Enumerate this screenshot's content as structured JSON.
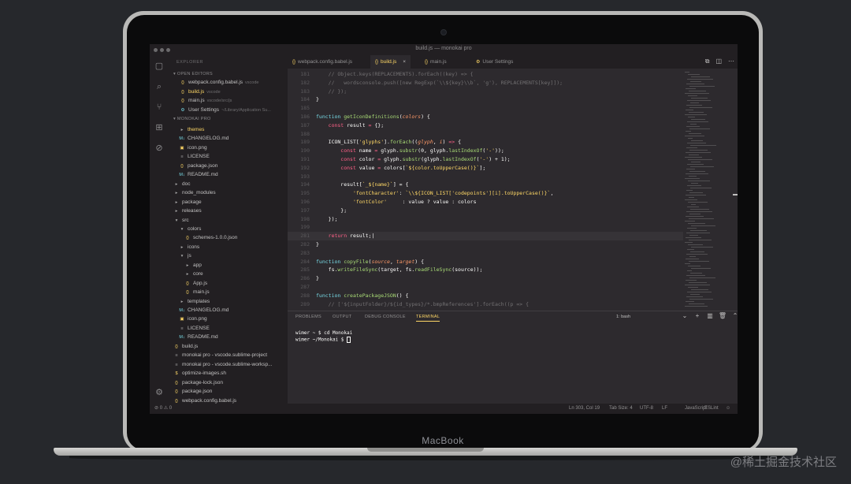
{
  "device": {
    "brand": "MacBook"
  },
  "window": {
    "title": "build.js — monokai pro"
  },
  "activity_bar": {
    "icons": [
      "files-icon",
      "search-icon",
      "source-control-icon",
      "extensions-icon",
      "debug-icon",
      "settings-icon"
    ]
  },
  "sidebar": {
    "header": "EXPLORER",
    "open_editors_label": "OPEN EDITORS",
    "open_editors": [
      {
        "name": "webpack.config.babel.js",
        "sub": "vscode",
        "kind": "js"
      },
      {
        "name": "build.js",
        "sub": "vscode",
        "kind": "js",
        "active": true
      },
      {
        "name": "main.js",
        "sub": "vscode/src/js",
        "kind": "js"
      },
      {
        "name": "User Settings",
        "sub": "~/Library/Application Su...",
        "kind": "settings"
      }
    ],
    "project_label": "MONOKAI PRO",
    "tree": [
      {
        "name": "themes",
        "depth": 1,
        "kind": "folder-closed",
        "active": true
      },
      {
        "name": "CHANGELOG.md",
        "depth": 1,
        "kind": "md"
      },
      {
        "name": "icon.png",
        "depth": 1,
        "kind": "img"
      },
      {
        "name": "LICENSE",
        "depth": 1,
        "kind": "file"
      },
      {
        "name": "package.json",
        "depth": 1,
        "kind": "json"
      },
      {
        "name": "README.md",
        "depth": 1,
        "kind": "md"
      },
      {
        "name": "doc",
        "depth": 0,
        "kind": "folder-closed"
      },
      {
        "name": "node_modules",
        "depth": 0,
        "kind": "folder-closed"
      },
      {
        "name": "package",
        "depth": 0,
        "kind": "folder-closed"
      },
      {
        "name": "releases",
        "depth": 0,
        "kind": "folder-closed"
      },
      {
        "name": "src",
        "depth": 0,
        "kind": "folder-open"
      },
      {
        "name": "colors",
        "depth": 1,
        "kind": "folder-open"
      },
      {
        "name": "schemes-1.0.0.json",
        "depth": 2,
        "kind": "json"
      },
      {
        "name": "icons",
        "depth": 1,
        "kind": "folder-closed"
      },
      {
        "name": "js",
        "depth": 1,
        "kind": "folder-open"
      },
      {
        "name": "app",
        "depth": 2,
        "kind": "folder-closed"
      },
      {
        "name": "core",
        "depth": 2,
        "kind": "folder-closed"
      },
      {
        "name": "App.js",
        "depth": 2,
        "kind": "js"
      },
      {
        "name": "main.js",
        "depth": 2,
        "kind": "js"
      },
      {
        "name": "templates",
        "depth": 1,
        "kind": "folder-closed"
      },
      {
        "name": "CHANGELOG.md",
        "depth": 1,
        "kind": "md"
      },
      {
        "name": "icon.png",
        "depth": 1,
        "kind": "img"
      },
      {
        "name": "LICENSE",
        "depth": 1,
        "kind": "file"
      },
      {
        "name": "README.md",
        "depth": 1,
        "kind": "md"
      },
      {
        "name": "build.js",
        "depth": 0,
        "kind": "js"
      },
      {
        "name": "monokai pro - vscode.sublime-project",
        "depth": 0,
        "kind": "file"
      },
      {
        "name": "monokai pro - vscode.sublime-worksp...",
        "depth": 0,
        "kind": "file"
      },
      {
        "name": "optimize-images.sh",
        "depth": 0,
        "kind": "sh"
      },
      {
        "name": "package-lock.json",
        "depth": 0,
        "kind": "json"
      },
      {
        "name": "package.json",
        "depth": 0,
        "kind": "json"
      },
      {
        "name": "webpack.config.babel.js",
        "depth": 0,
        "kind": "js"
      }
    ]
  },
  "tabs": [
    {
      "label": "webpack.config.babel.js",
      "kind": "js"
    },
    {
      "label": "build.js",
      "kind": "js",
      "active": true,
      "close": "×"
    },
    {
      "label": "main.js",
      "kind": "js"
    },
    {
      "label": "User Settings",
      "kind": "settings"
    }
  ],
  "editor": {
    "current_line": 281,
    "lines": [
      {
        "n": "181",
        "code": [
          [
            "c-com",
            "    // Object.keys(REPLACEMENTS).forEach((key) => {"
          ]
        ]
      },
      {
        "n": "182",
        "code": [
          [
            "c-com",
            "    //   wordsconsole.push([new RegExp(`\\\\${key}\\\\b`, 'g'), REPLACEMENTS[key]]);"
          ]
        ]
      },
      {
        "n": "183",
        "code": [
          [
            "c-com",
            "    // });"
          ]
        ]
      },
      {
        "n": "184",
        "code": [
          [
            "c-var",
            "}"
          ]
        ]
      },
      {
        "n": "185",
        "code": []
      },
      {
        "n": "186",
        "code": [
          [
            "c-blue",
            "function "
          ],
          [
            "c-fn",
            "getIconDefinitions"
          ],
          [
            "c-var",
            "("
          ],
          [
            "c-par",
            "colors"
          ],
          [
            "c-var",
            ") {"
          ]
        ]
      },
      {
        "n": "187",
        "code": [
          [
            "c-kw",
            "    const "
          ],
          [
            "c-var",
            "result "
          ],
          [
            "c-kw",
            "= "
          ],
          [
            "c-var",
            "{};"
          ]
        ]
      },
      {
        "n": "188",
        "code": []
      },
      {
        "n": "189",
        "code": [
          [
            "c-var",
            "    ICON_LIST["
          ],
          [
            "c-str",
            "'glyphs'"
          ],
          [
            "c-var",
            "]."
          ],
          [
            "c-fn",
            "forEach"
          ],
          [
            "c-var",
            "(("
          ],
          [
            "c-par",
            "glyph"
          ],
          [
            "c-var",
            ", "
          ],
          [
            "c-par",
            "i"
          ],
          [
            "c-var",
            ") "
          ],
          [
            "c-kw",
            "=> "
          ],
          [
            "c-var",
            "{"
          ]
        ]
      },
      {
        "n": "190",
        "code": [
          [
            "c-kw",
            "        const "
          ],
          [
            "c-var",
            "name "
          ],
          [
            "c-kw",
            "= "
          ],
          [
            "c-var",
            "glyph."
          ],
          [
            "c-fn",
            "substr"
          ],
          [
            "c-var",
            "(0, glyph."
          ],
          [
            "c-fn",
            "lastIndexOf"
          ],
          [
            "c-var",
            "("
          ],
          [
            "c-str",
            "'-'"
          ],
          [
            "c-var",
            "));"
          ]
        ]
      },
      {
        "n": "191",
        "code": [
          [
            "c-kw",
            "        const "
          ],
          [
            "c-var",
            "color "
          ],
          [
            "c-kw",
            "= "
          ],
          [
            "c-var",
            "glyph."
          ],
          [
            "c-fn",
            "substr"
          ],
          [
            "c-var",
            "(glyph."
          ],
          [
            "c-fn",
            "lastIndexOf"
          ],
          [
            "c-var",
            "("
          ],
          [
            "c-str",
            "'-'"
          ],
          [
            "c-var",
            ") + 1);"
          ]
        ]
      },
      {
        "n": "192",
        "code": [
          [
            "c-kw",
            "        const "
          ],
          [
            "c-var",
            "value "
          ],
          [
            "c-kw",
            "= "
          ],
          [
            "c-var",
            "colors["
          ],
          [
            "c-str",
            "`${color.toUpperCase()}`"
          ],
          [
            "c-var",
            "];"
          ]
        ]
      },
      {
        "n": "193",
        "code": []
      },
      {
        "n": "194",
        "code": [
          [
            "c-var",
            "        result["
          ],
          [
            "c-str",
            "`_${name}`"
          ],
          [
            "c-var",
            "] = {"
          ]
        ]
      },
      {
        "n": "195",
        "code": [
          [
            "c-str",
            "            'fontCharacter'"
          ],
          [
            "c-var",
            ": "
          ],
          [
            "c-str",
            "`\\\\${ICON_LIST['codepoints'][i].toUpperCase()}`"
          ],
          [
            "c-var",
            ","
          ]
        ]
      },
      {
        "n": "196",
        "code": [
          [
            "c-str",
            "            'fontColor'"
          ],
          [
            "c-var",
            "     : value ? value : colors"
          ]
        ]
      },
      {
        "n": "197",
        "code": [
          [
            "c-var",
            "        };"
          ]
        ]
      },
      {
        "n": "198",
        "code": [
          [
            "c-var",
            "    });"
          ]
        ]
      },
      {
        "n": "199",
        "code": []
      },
      {
        "n": "281",
        "code": [
          [
            "c-kw",
            "    return "
          ],
          [
            "c-var",
            "result;"
          ]
        ],
        "cursor": true
      },
      {
        "n": "282",
        "code": [
          [
            "c-var",
            "}"
          ]
        ]
      },
      {
        "n": "283",
        "code": []
      },
      {
        "n": "284",
        "code": [
          [
            "c-blue",
            "function "
          ],
          [
            "c-fn",
            "copyFile"
          ],
          [
            "c-var",
            "("
          ],
          [
            "c-par",
            "source"
          ],
          [
            "c-var",
            ", "
          ],
          [
            "c-par",
            "target"
          ],
          [
            "c-var",
            ") {"
          ]
        ]
      },
      {
        "n": "285",
        "code": [
          [
            "c-var",
            "    fs."
          ],
          [
            "c-fn",
            "writeFileSync"
          ],
          [
            "c-var",
            "(target, fs."
          ],
          [
            "c-fn",
            "readFileSync"
          ],
          [
            "c-var",
            "(source));"
          ]
        ]
      },
      {
        "n": "286",
        "code": [
          [
            "c-var",
            "}"
          ]
        ]
      },
      {
        "n": "287",
        "code": []
      },
      {
        "n": "288",
        "code": [
          [
            "c-blue",
            "function "
          ],
          [
            "c-fn",
            "createPackageJSON"
          ],
          [
            "c-var",
            "() {"
          ]
        ]
      },
      {
        "n": "289",
        "code": [
          [
            "c-com",
            "    // ['${inputFolder}/${id_types}/*.bmpReferences'].forEach((p => {"
          ]
        ]
      }
    ]
  },
  "panel": {
    "tabs": [
      {
        "label": "PROBLEMS"
      },
      {
        "label": "OUTPUT"
      },
      {
        "label": "DEBUG CONSOLE"
      },
      {
        "label": "TERMINAL",
        "active": true
      }
    ],
    "terminal_select": "1: bash",
    "actions": [
      "⌄",
      "+",
      "▥",
      "🗑",
      "⌃",
      "×"
    ],
    "terminal_lines": [
      "wimer ~ $ cd Monokai",
      "wimer ~/Monokai $ "
    ]
  },
  "statusbar": {
    "left": "⊘ 0 ⚠ 0",
    "items": [
      "Ln 303, Col 19",
      "Tab Size: 4",
      "UTF-8",
      "LF",
      "JavaScript",
      "ESLint",
      "☺"
    ]
  },
  "watermark": "@稀土掘金技术社区",
  "colors": {
    "accent": "#ffd866",
    "editor_bg": "#2d2a2e",
    "sidebar_bg": "#221f22"
  }
}
